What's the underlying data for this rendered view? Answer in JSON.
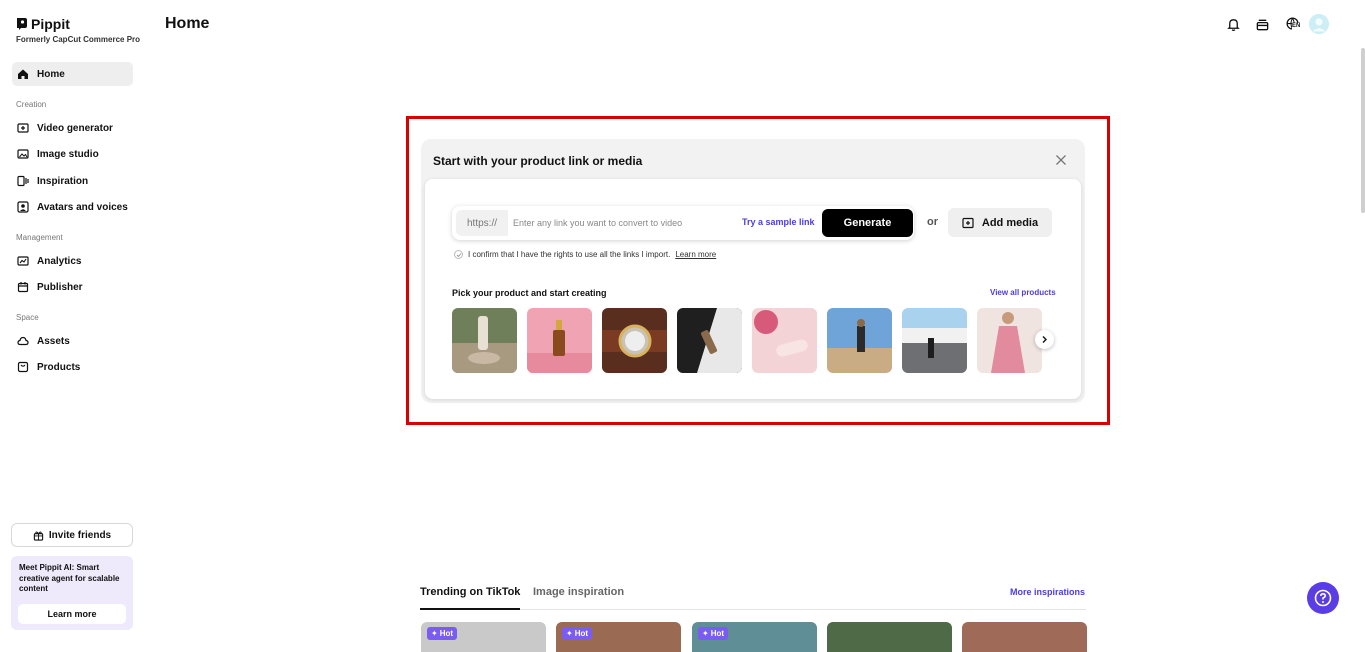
{
  "brand": {
    "name": "Pippit",
    "subtitle": "Formerly CapCut Commerce Pro"
  },
  "sidebar": {
    "home": "Home",
    "sections": {
      "creation": "Creation",
      "management": "Management",
      "space": "Space"
    },
    "creation_items": [
      "Video generator",
      "Image studio",
      "Inspiration",
      "Avatars and voices"
    ],
    "management_items": [
      "Analytics",
      "Publisher"
    ],
    "space_items": [
      "Assets",
      "Products"
    ],
    "invite_label": "Invite friends",
    "promo": {
      "text": "Meet Pippit AI: Smart creative agent for scalable content",
      "button": "Learn more"
    }
  },
  "header": {
    "title": "Home",
    "language_code": "EN"
  },
  "start_card": {
    "title": "Start with your product link or media",
    "link_prefix": "https://",
    "link_placeholder": "Enter any link you want to convert to video",
    "link_value": "",
    "sample_link": "Try a sample link",
    "generate_label": "Generate",
    "or_text": "or",
    "add_media_label": "Add media",
    "confirm_text": "I confirm that I have the rights to use all the links I import.",
    "confirm_link": "Learn more",
    "pick_title": "Pick your product and start creating",
    "view_all": "View all products"
  },
  "trending": {
    "tabs": [
      "Trending on TikTok",
      "Image inspiration"
    ],
    "more_label": "More inspirations",
    "badge": "Hot"
  },
  "colors": {
    "accent": "#4b3de0",
    "highlight": "#d80000",
    "help": "#5b3de6",
    "hot": "#7b5cf0"
  }
}
